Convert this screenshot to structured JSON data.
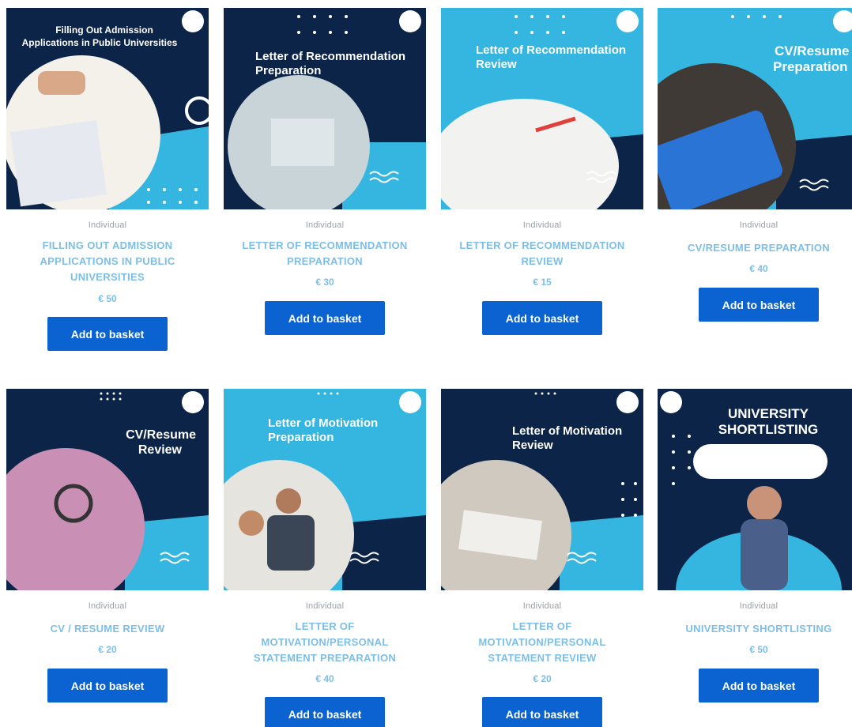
{
  "colors": {
    "navy": "#0b2447",
    "cyan": "#35b6e0",
    "button": "#0a63d1",
    "title": "#7dbee6"
  },
  "products": [
    {
      "category": "Individual",
      "title": "FILLING OUT ADMISSION APPLICATIONS IN PUBLIC UNIVERSITIES",
      "price": "€ 50",
      "button": "Add to basket",
      "image_text": {
        "line1": "Filling Out Admission",
        "line2": "Applications in Public Universities"
      }
    },
    {
      "category": "Individual",
      "title": "LETTER OF RECOMMENDATION PREPARATION",
      "price": "€ 30",
      "button": "Add to basket",
      "image_text": {
        "line1": "Letter of Recommendation",
        "line2": "Preparation"
      }
    },
    {
      "category": "Individual",
      "title": "LETTER OF RECOMMENDATION REVIEW",
      "price": "€ 15",
      "button": "Add to basket",
      "image_text": {
        "line1": "Letter of Recommendation",
        "line2": "Review"
      }
    },
    {
      "category": "Individual",
      "title": "CV/RESUME PREPARATION",
      "price": "€ 40",
      "button": "Add to basket",
      "image_text": {
        "line1": "CV/Resume",
        "line2": "Preparation"
      }
    },
    {
      "category": "Individual",
      "title": "CV / RESUME REVIEW",
      "price": "€ 20",
      "button": "Add to basket",
      "image_text": {
        "line1": "CV/Resume",
        "line2": "Review"
      }
    },
    {
      "category": "Individual",
      "title": "LETTER OF MOTIVATION/PERSONAL STATEMENT PREPARATION",
      "price": "€ 40",
      "button": "Add to basket",
      "image_text": {
        "line1": "Letter of Motivation",
        "line2": "Preparation"
      }
    },
    {
      "category": "Individual",
      "title": "LETTER OF MOTIVATION/PERSONAL STATEMENT REVIEW",
      "price": "€ 20",
      "button": "Add to basket",
      "image_text": {
        "line1": "Letter of Motivation",
        "line2": "Review"
      }
    },
    {
      "category": "Individual",
      "title": "UNIVERSITY SHORTLISTING",
      "price": "€ 50",
      "button": "Add to basket",
      "image_text": {
        "line1": "UNIVERSITY",
        "line2": "SHORTLISTING"
      }
    }
  ]
}
